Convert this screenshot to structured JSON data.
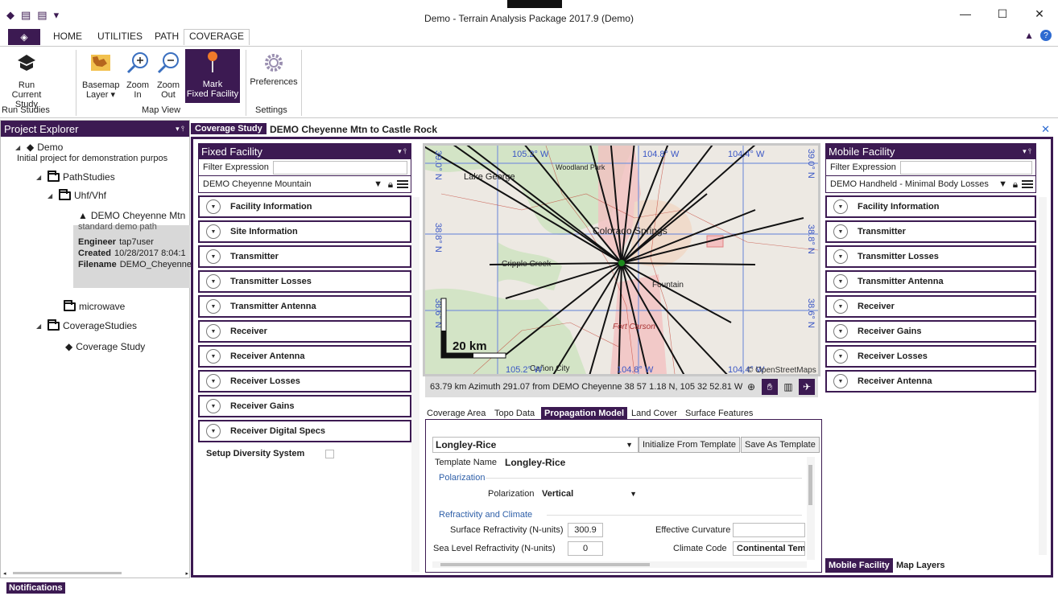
{
  "window": {
    "title": "Demo - Terrain Analysis Package 2017.9 (Demo)"
  },
  "ribbon_tabs": [
    "HOME",
    "UTILITIES",
    "PATH",
    "COVERAGE"
  ],
  "ribbon": {
    "run_label1": "Run",
    "run_label2": "Current Study",
    "basemap_label1": "Basemap",
    "basemap_label2": "Layer",
    "zoomin_label1": "Zoom",
    "zoomin_label2": "In",
    "zoomout_label1": "Zoom",
    "zoomout_label2": "Out",
    "mark_label1": "Mark",
    "mark_label2": "Fixed Facility",
    "prefs_label": "Preferences",
    "groups": [
      "Run Studies",
      "Map View",
      "Settings"
    ]
  },
  "explorer": {
    "title": "Project Explorer",
    "root": "Demo",
    "root_desc": "Initial project for demonstration purpos",
    "path_studies": "PathStudies",
    "uhf": "Uhf/Vhf",
    "item": "DEMO Cheyenne Mtn",
    "item_desc": "standard demo path",
    "engineer_label": "Engineer",
    "engineer": "tap7user",
    "created_label": "Created",
    "created": "10/28/2017 8:04:1",
    "filename_label": "Filename",
    "filename": "DEMO_Cheyenne_",
    "microwave": "microwave",
    "coverage_studies": "CoverageStudies",
    "coverage_study": "Coverage Study"
  },
  "doc": {
    "tab": "Coverage Study",
    "name": "DEMO Cheyenne Mtn to Castle Rock"
  },
  "fixed": {
    "title": "Fixed Facility",
    "filter_label": "Filter Expression",
    "selected": "DEMO Cheyenne Mountain",
    "sections": [
      "Facility Information",
      "Site Information",
      "Transmitter",
      "Transmitter Losses",
      "Transmitter Antenna",
      "Receiver",
      "Receiver Antenna",
      "Receiver Losses",
      "Receiver Gains",
      "Receiver Digital Specs"
    ],
    "diversity": "Setup Diversity System"
  },
  "map": {
    "lon_top": [
      "105.2° W",
      "104.8° W",
      "104.4° W"
    ],
    "lon_bottom": [
      "105.2° W",
      "104.8° W",
      "104.4° W"
    ],
    "lat_left": [
      "39.0° N",
      "38.8° N",
      "38.6° N"
    ],
    "lat_right": [
      "39.0° N",
      "38.8° N",
      "38.6° N"
    ],
    "places": [
      "Lake George",
      "Woodland Park",
      "Colorado Springs",
      "Cripple Creek",
      "Fountain",
      "Fort Carson",
      "Cañon City"
    ],
    "scale": "20 km",
    "attribution": "© OpenStreetMaps",
    "status": "63.79 km Azimuth 291.07 from DEMO Cheyenne 38 57 1.18 N, 105 32 52.81 W"
  },
  "prop_tabs": [
    "Coverage Area",
    "Topo Data",
    "Propagation Model",
    "Land Cover",
    "Surface Features"
  ],
  "prop": {
    "model": "Longley-Rice",
    "init_btn": "Initialize From Template",
    "save_btn": "Save As Template",
    "template_label": "Template Name",
    "template_value": "Longley-Rice",
    "polarization_group": "Polarization",
    "polarization_label": "Polarization",
    "polarization_value": "Vertical",
    "refr_group": "Refractivity and Climate",
    "surf_label": "Surface Refractivity (N-units)",
    "surf_value": "300.9",
    "curv_label": "Effective Curvature",
    "sea_label": "Sea Level Refractivity (N-units)",
    "sea_value": "0",
    "climate_label": "Climate Code",
    "climate_value": "Continental Temp"
  },
  "mobile": {
    "title": "Mobile Facility",
    "filter_label": "Filter Expression",
    "selected": "DEMO Handheld - Minimal Body Losses",
    "sections": [
      "Facility Information",
      "Transmitter",
      "Transmitter Losses",
      "Transmitter Antenna",
      "Receiver",
      "Receiver Gains",
      "Receiver Losses",
      "Receiver Antenna"
    ],
    "bottom_tabs": [
      "Mobile Facility",
      "Map Layers"
    ]
  },
  "notifications": "Notifications",
  "colors": {
    "accent": "#3c1a52",
    "link": "#2e6bd1"
  }
}
